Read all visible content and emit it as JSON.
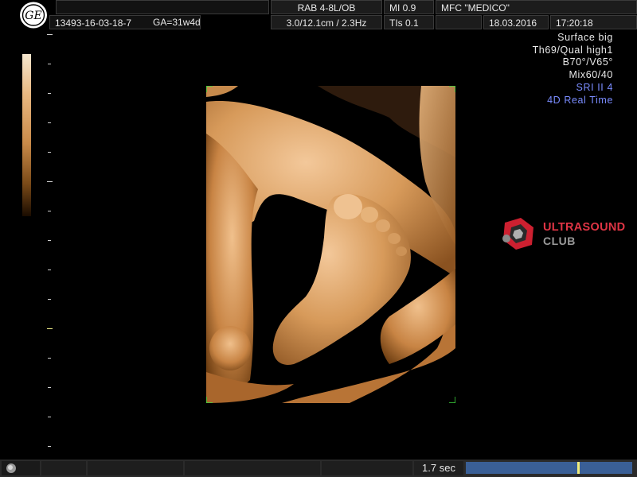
{
  "header": {
    "probe": "RAB 4-8L/OB",
    "mi": "MI  0.9",
    "facility": "MFC \"MEDICO\"",
    "patient_id": "13493-16-03-18-7",
    "ga": "GA=31w4d",
    "depth_freq": "3.0/12.1cm / 2.3Hz",
    "tis": "TIs  0.1",
    "date": "18.03.2016",
    "time": "17:20:18"
  },
  "params": [
    {
      "text": "Surface big",
      "color": "white"
    },
    {
      "text": "Th69/Qual high1",
      "color": "white"
    },
    {
      "text": "B70°/V65°",
      "color": "white"
    },
    {
      "text": "Mix60/40",
      "color": "white"
    },
    {
      "text": "SRI II 4",
      "color": "blue"
    },
    {
      "text": "4D Real Time",
      "color": "blue"
    }
  ],
  "brand": {
    "line1": "ULTRASOUND",
    "line2": "CLUB",
    "color": "#e03545"
  },
  "status": {
    "elapsed": "1.7 sec",
    "progress_marker": 0.67
  },
  "colors": {
    "accent_blue": "#7a8cff",
    "progress": "#3a5f96",
    "marker": "#f2ed7a",
    "sepia": "#d79a5a"
  },
  "icons": {
    "logo": "ge-logo-icon",
    "brand": "ultrasound-club-logo-icon"
  }
}
